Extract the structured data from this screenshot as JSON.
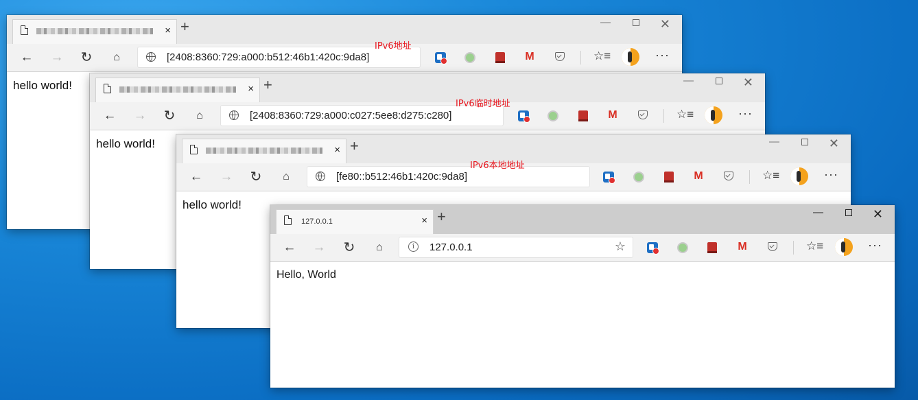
{
  "windows": [
    {
      "tab_title_blurred": true,
      "url": "[2408:8360:729:a000:b512:46b1:420c:9da8]",
      "content": "hello world!",
      "annotation": "IPv6地址"
    },
    {
      "tab_title_blurred": true,
      "url": "[2408:8360:729:a000:c027:5ee8:d275:c280]",
      "content": "hello world!",
      "annotation": "IPv6临时地址"
    },
    {
      "tab_title_blurred": true,
      "url": "[fe80::b512:46b1:420c:9da8]",
      "content": "hello world!",
      "annotation": "IPv6本地地址"
    },
    {
      "tab_title": "127.0.0.1",
      "url": "127.0.0.1",
      "content": "Hello, World"
    }
  ],
  "icons": {
    "tab_close": "×",
    "new_tab": "+",
    "minimize": "—",
    "close": "✕",
    "back": "←",
    "forward": "→",
    "refresh": "↻",
    "home": "⌂",
    "favorites": "☆≡",
    "more": "···",
    "star": "☆",
    "gmail": "M"
  },
  "colors": {
    "annotation": "#e8151d",
    "desktop": "#0a6cc2"
  }
}
